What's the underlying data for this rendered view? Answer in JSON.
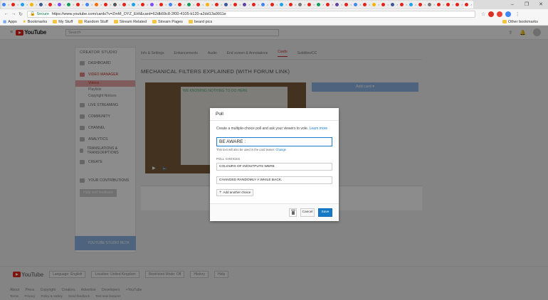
{
  "browser": {
    "window_controls": [
      "–",
      "❐",
      "✕"
    ],
    "url": "https://www.youtube.com/cards?v=ZmM_OYZ_EHI&card=62db59c8-2f00-4105-b120-a2dd13a9911e",
    "secure_label": "Secure",
    "bookmarks": [
      "Apps",
      "Bookmarks",
      "My Stuff",
      "Random Stuff",
      "Stream Related",
      "Stream Pages",
      "beard pics"
    ],
    "other_bookmarks": "Other bookmarks",
    "tab_colors": [
      "#4285f4",
      "#e62117",
      "#1da1f2",
      "#f4b400",
      "#3b5998",
      "#e62117",
      "#7c4dff",
      "#0f9d58",
      "#e62117",
      "#4285f4",
      "#ff6d00",
      "#e62117",
      "#555555",
      "#e62117",
      "#1da1f2",
      "#e62117",
      "#7c4dff",
      "#e62117",
      "#4285f4",
      "#e62117",
      "#0f9d58",
      "#e62117",
      "#f4b400",
      "#e62117",
      "#3b5998",
      "#e62117",
      "#6441a5",
      "#e62117",
      "#4285f4",
      "#e62117",
      "#1da1f2",
      "#e62117",
      "#777777",
      "#e62117",
      "#0f9d58",
      "#e62117",
      "#6441a5",
      "#e62117",
      "#4285f4",
      "#e62117",
      "#f4b400",
      "#e62117",
      "#3b5998",
      "#e62117",
      "#1da1f2",
      "#e62117",
      "#777777",
      "#e62117",
      "#e62117",
      "#e62117",
      "#e62117"
    ]
  },
  "youtube": {
    "logo": "YouTube",
    "search_placeholder": "Search",
    "studio_title": "CREATOR STUDIO",
    "sidebar": [
      {
        "label": "DASHBOARD"
      },
      {
        "label": "VIDEO MANAGER"
      },
      {
        "label": "LIVE STREAMING"
      },
      {
        "label": "COMMUNITY"
      },
      {
        "label": "CHANNEL"
      },
      {
        "label": "ANALYTICS"
      },
      {
        "label": "TRANSLATIONS & TRANSCRIPTIONS"
      },
      {
        "label": "CREATE"
      },
      {
        "label": "YOUR CONTRIBUTIONS"
      }
    ],
    "sidebar_sub": [
      "Videos",
      "Playlists",
      "Copyright Notices"
    ],
    "help_button": "Help and feedback",
    "studio_beta": "YOUTUBE STUDIO BETA",
    "tabs": [
      "Info & Settings",
      "Enhancements",
      "Audio",
      "End screen & Annotations",
      "Cards",
      "Subtitles/CC"
    ],
    "video_title": "MECHANICAL FILTERS EXPLAINED (WITH FORUM LINK)",
    "video_overlay": "WE KNOWING NOTHING TO DO HERE",
    "add_card": "Add card ▾",
    "footer_pills": [
      "Language: English",
      "Location: United Kingdom",
      "Restricted Mode: Off",
      "History",
      "Help"
    ],
    "footer_links": [
      "About",
      "Press",
      "Copyright",
      "Creators",
      "Advertise",
      "Developers",
      "+YouTube"
    ],
    "footer_links2": [
      "Terms",
      "Privacy",
      "Policy & Safety",
      "Send feedback",
      "Test new features"
    ]
  },
  "poll": {
    "title": "Poll",
    "description": "Create a multiple-choice poll and ask your viewers to vote.",
    "learn_more": "Learn more",
    "question_value": "BE AWARE :",
    "hint": "This text will also be used in the card teaser.",
    "hint_link": "Change",
    "choices_label": "POLL CHOICES",
    "choices": [
      "COLOURS OF IN/OUTPUTS WERE",
      "CHANGED RANDOMLY A WHILE BACK."
    ],
    "add_choice": "Add another choice",
    "cancel": "Cancel",
    "save": "Save",
    "accent": "#167ac6"
  }
}
